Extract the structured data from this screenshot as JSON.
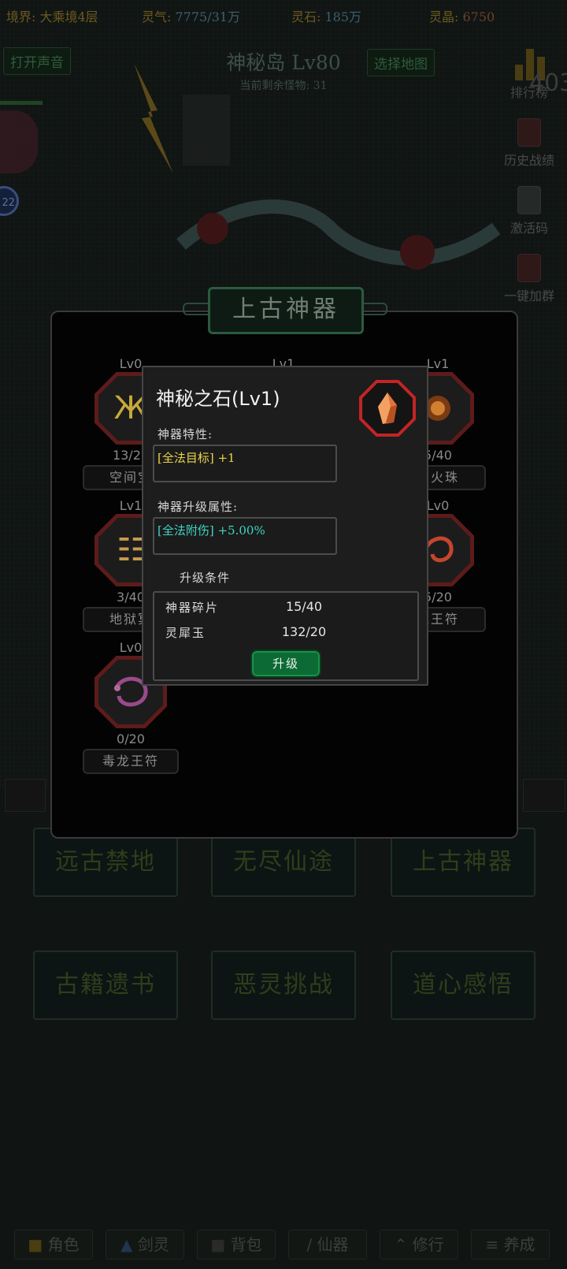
{
  "status_bar": {
    "realm": "境界: 大乘境4层",
    "lingqi_label": "灵气: ",
    "lingqi_value": "7775/31万",
    "lingshi_label": "灵石: ",
    "lingshi_value": "185万",
    "lingpin_label": "灵晶: ",
    "lingpin_value": "6750"
  },
  "top": {
    "sound_button": "打开声音",
    "map_title": "神秘岛 Lv80",
    "map_subtitle": "当前剩余怪物: 31",
    "select_map_button": "选择地图",
    "badge_value": "22",
    "rank_number": "403"
  },
  "side_menu": [
    "排行榜",
    "历史战绩",
    "激活码",
    "一键加群"
  ],
  "bottom_buttons": [
    "远古禁地",
    "无尽仙途",
    "上古神器",
    "古籍遗书",
    "恶灵挑战",
    "道心感悟"
  ],
  "tabs": [
    "角色",
    "剑灵",
    "背包",
    "仙器",
    "修行",
    "养成"
  ],
  "panel": {
    "title": "上古神器",
    "artifacts": [
      {
        "level": "Lv0",
        "count": "13/20",
        "name": "空间宝",
        "icon": "golden-rune-icon",
        "color": "#c8a93a"
      },
      {
        "level": "Lv1",
        "count": "",
        "name": "",
        "icon": "hidden",
        "color": "#888888"
      },
      {
        "level": "Lv1",
        "count": "5/40",
        "name": "炎火珠",
        "icon": "fire-orb-icon",
        "color": "#d08030"
      },
      {
        "level": "Lv1",
        "count": "3/40",
        "name": "地狱冥",
        "icon": "demon-mask-icon",
        "color": "#c99a4e"
      },
      {
        "level": "Lv0",
        "count": "5/20",
        "name": "龙王符",
        "icon": "red-dragon-icon",
        "color": "#c4462d"
      },
      {
        "level": "Lv0",
        "count": "0/20",
        "name": "毒龙王符",
        "icon": "purple-dragon-icon",
        "color": "#9a4a8a"
      }
    ]
  },
  "dialog": {
    "title": "神秘之石(Lv1)",
    "icon": "orange-crystal-icon",
    "trait_label": "神器特性:",
    "trait_value": "[全法目标] +1",
    "trait_color": "#e9d44a",
    "upgrade_attr_label": "神器升级属性:",
    "upgrade_attr_value": "[全法附伤] +5.00%",
    "upgrade_attr_color": "#3fd6c6",
    "requirements_label": "升级条件",
    "requirements": [
      {
        "name": "神器碎片",
        "value": "15/40"
      },
      {
        "name": "灵犀玉",
        "value": "132/20"
      }
    ],
    "upgrade_button": "升级"
  }
}
